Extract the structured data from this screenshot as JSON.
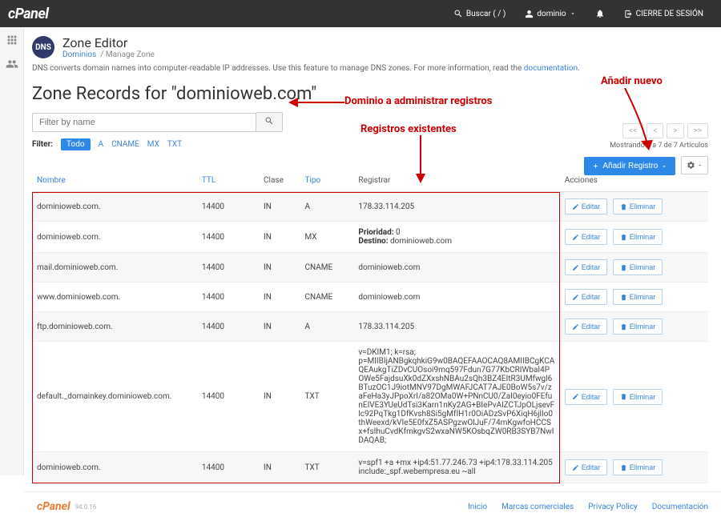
{
  "topbar": {
    "logo": "cPanel",
    "search": "Buscar ( / )",
    "user": "dominio",
    "logout": "CIERRE DE SESIÓN"
  },
  "header": {
    "badge": "DNS",
    "title": "Zone Editor",
    "crumb_link": "Dominios",
    "crumb_current": "Manage Zone"
  },
  "intro_text": "DNS converts domain names into computer-readable IP addresses. Use this feature to manage DNS zones. For more information, read the ",
  "intro_link": "documentation",
  "zone_title": "Zone Records for \"dominioweb.com\"",
  "filter": {
    "placeholder": "Filter by name",
    "label": "Filter:",
    "pills": {
      "all": "Todo",
      "a": "A",
      "cname": "CNAME",
      "mx": "MX",
      "txt": "TXT"
    }
  },
  "pager": {
    "first": "<<",
    "prev": "<",
    "next": ">",
    "last": ">>",
    "count": "Mostrando 1 a 7 de 7 Artículos"
  },
  "add_btn": "Añadir Registro",
  "columns": {
    "name": "Nombre",
    "ttl": "TTL",
    "class": "Clase",
    "type": "Tipo",
    "reg": "Registrar",
    "act": "Acciones"
  },
  "actions": {
    "edit": "Editar",
    "delete": "Eliminar"
  },
  "rows": [
    {
      "name": "dominioweb.com.",
      "ttl": "14400",
      "class": "IN",
      "type": "A",
      "reg": "178.33.114.205"
    },
    {
      "name": "dominioweb.com.",
      "ttl": "14400",
      "class": "IN",
      "type": "MX",
      "reg_html": "<b>Prioridad:</b> 0<br><b>Destino:</b> dominioweb.com"
    },
    {
      "name": "mail.dominioweb.com.",
      "ttl": "14400",
      "class": "IN",
      "type": "CNAME",
      "reg": "dominioweb.com"
    },
    {
      "name": "www.dominioweb.com.",
      "ttl": "14400",
      "class": "IN",
      "type": "CNAME",
      "reg": "dominioweb.com"
    },
    {
      "name": "ftp.dominioweb.com.",
      "ttl": "14400",
      "class": "IN",
      "type": "A",
      "reg": "178.33.114.205"
    },
    {
      "name": "default._domainkey.dominioweb.com.",
      "ttl": "14400",
      "class": "IN",
      "type": "TXT",
      "reg": "v=DKIM1; k=rsa; p=MIIBIjANBgkqhkiG9w0BAQEFAAOCAQ8AMIIBCgKCAQEAukgTiZDvCUOsoi9mq597Fdun7G77KbCRIWbaI4POWe5FajdsuXk0dZXxshNBAu2sQh3BZ4EItR3UMfwgl6BTuzOC1J9iotMNV97DgMWAFJCAT7AJE0BoW5s7v/zaFeHa3yJPpoXrI/a82OMa0W+PNnCU0/ZaI0eyio0FEfunEIVE3YUeUdTsi3Karn1nKy2AG+BIePvAlZCTJpOLjsevFlc92PqTkg1DfKvsh8Si5gMfIH1r0OiADzSvP6XiqH6jlIo0thWeexd/kVIe5E0fxZ5ASPgzwOlJuF/74mKgwfoHCCSx+fsIhuCvdKfmkgvS2wxaNW5KOsbqZW0RB3SYB7NwIDAQAB;"
    },
    {
      "name": "dominioweb.com.",
      "ttl": "14400",
      "class": "IN",
      "type": "TXT",
      "reg": "v=spf1 +a +mx +ip4:51.77.246.73 +ip4:178.33.114.205 include:_spf.webempresa.eu ~all"
    }
  ],
  "annotations": {
    "a1": "Dominio a administrar registros",
    "a2": "Registros existentes",
    "a3": "Añadir nuevo"
  },
  "footer": {
    "logo": "cPanel",
    "version": "94.0.16",
    "links": {
      "home": "Inicio",
      "trademarks": "Marcas comerciales",
      "privacy": "Privacy Policy",
      "docs": "Documentación"
    }
  }
}
